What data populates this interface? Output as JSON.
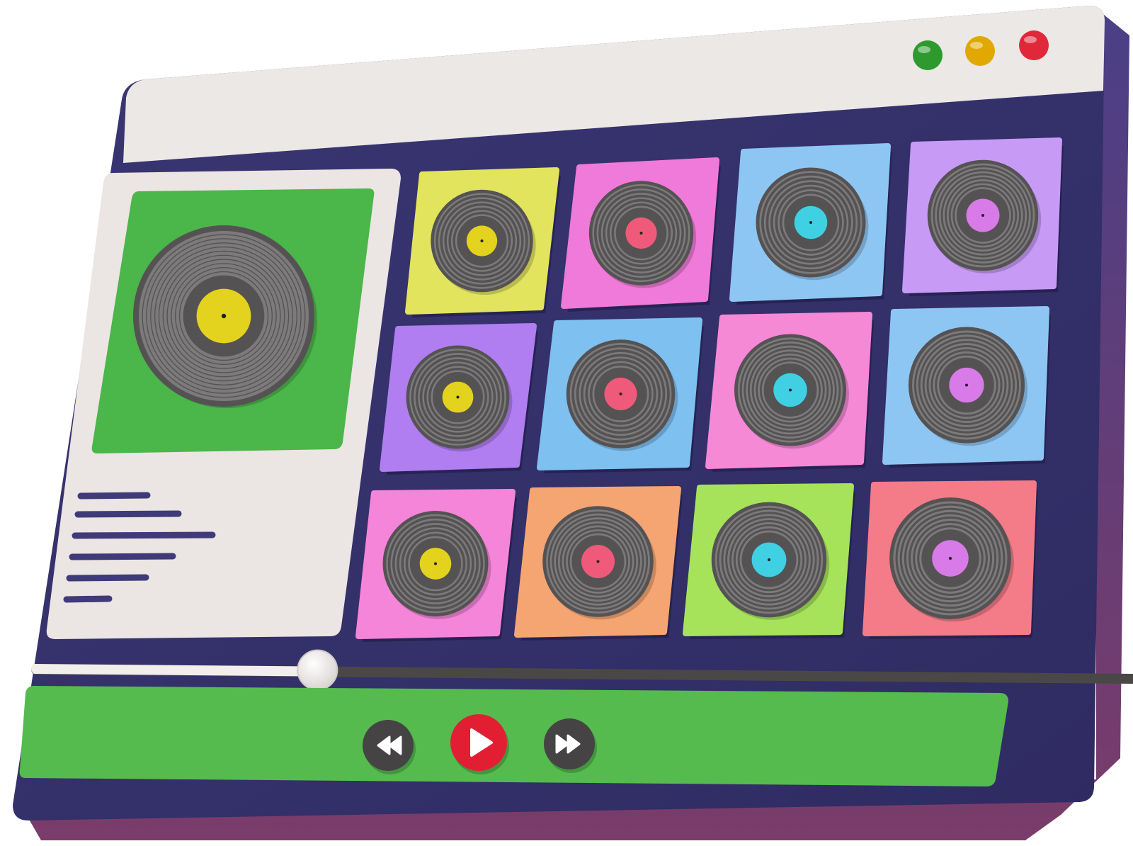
{
  "window": {
    "controls": [
      {
        "name": "maximize-button",
        "color": "#2e9a2e"
      },
      {
        "name": "minimize-button",
        "color": "#e0a800"
      },
      {
        "name": "close-button",
        "color": "#e0283a"
      }
    ]
  },
  "colors": {
    "titlebar": "#ece8e6",
    "body": "#3f3b78",
    "body_edge": "#6a3b6e",
    "panel": "#ebe5e3",
    "featured_cover": "#4bb64a",
    "controls_bar": "#55bb4f",
    "vinyl": "#555253",
    "vinyl_groove": "#7d7a7b",
    "text_line": "#3f3b78",
    "play_button": "#e21f32",
    "nav_button": "#454344"
  },
  "now_playing": {
    "cover_color": "#4bb64a",
    "label_color": "#e3d21e",
    "info_line_count": 6
  },
  "album_grid": [
    {
      "cover": "#e2e45e",
      "label": "#e3d21e"
    },
    {
      "cover": "#f07ad9",
      "label": "#f05a7a"
    },
    {
      "cover": "#8ec6f3",
      "label": "#3fd0e4"
    },
    {
      "cover": "#c79af6",
      "label": "#d87ae8"
    },
    {
      "cover": "#b07ef0",
      "label": "#e3d21e"
    },
    {
      "cover": "#7ec0f0",
      "label": "#f05a7a"
    },
    {
      "cover": "#f589d6",
      "label": "#3fd0e4"
    },
    {
      "cover": "#8ec6f3",
      "label": "#d87ae8"
    },
    {
      "cover": "#f585d8",
      "label": "#e3d21e"
    },
    {
      "cover": "#f4a572",
      "label": "#f05a7a"
    },
    {
      "cover": "#a6e35b",
      "label": "#3fd0e4"
    },
    {
      "cover": "#f47b88",
      "label": "#d87ae8"
    }
  ],
  "player": {
    "progress": 0.24,
    "buttons": [
      "rewind-icon",
      "play-icon",
      "fast-forward-icon"
    ]
  }
}
